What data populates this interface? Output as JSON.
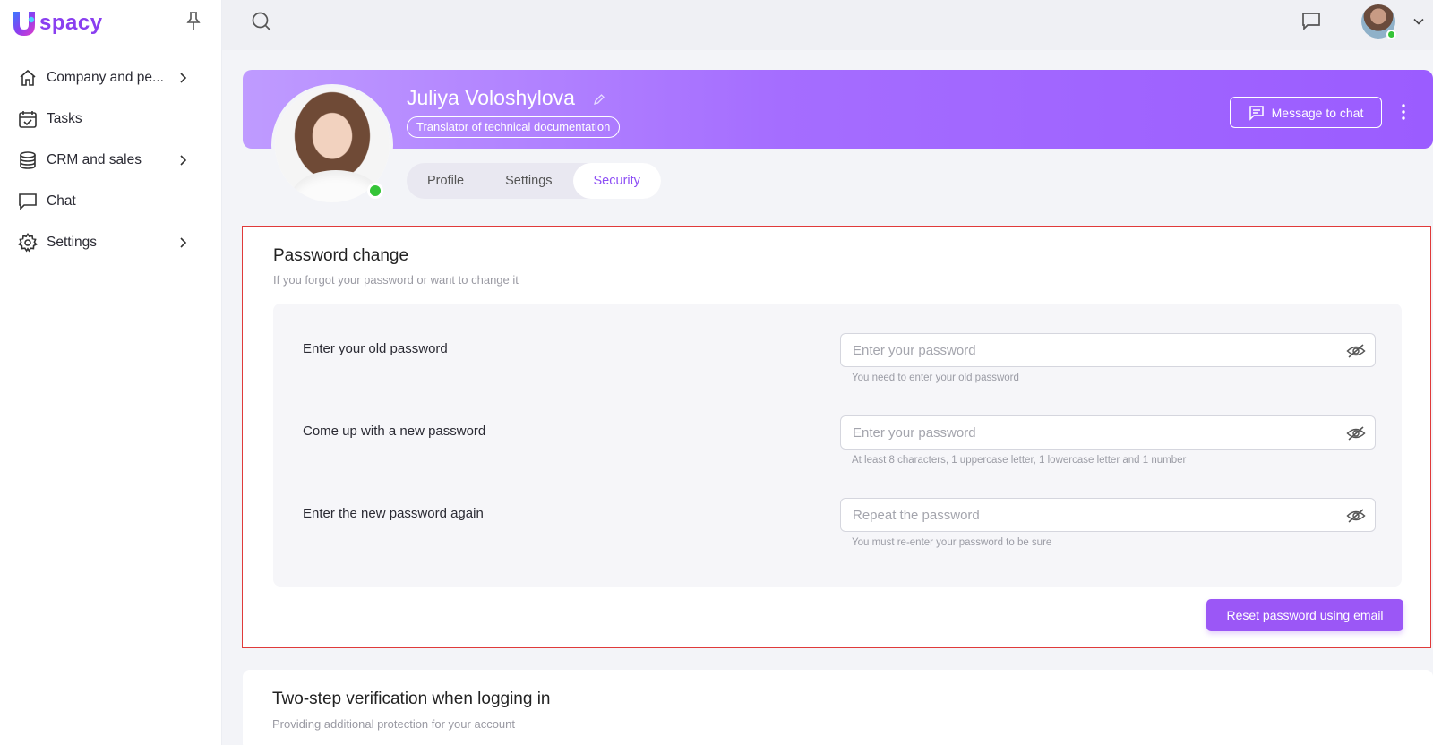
{
  "brand": {
    "name": "spacy",
    "accent": "#9b57f6"
  },
  "sidebar": {
    "items": [
      {
        "label": "Company and pe...",
        "icon": "home-icon",
        "has_children": true
      },
      {
        "label": "Tasks",
        "icon": "calendar-check-icon",
        "has_children": false
      },
      {
        "label": "CRM and sales",
        "icon": "database-icon",
        "has_children": true
      },
      {
        "label": "Chat",
        "icon": "chat-bubble-icon",
        "has_children": false
      },
      {
        "label": "Settings",
        "icon": "gear-icon",
        "has_children": true
      }
    ]
  },
  "profile": {
    "name": "Juliya Voloshylova",
    "role": "Translator of technical documentation",
    "message_button": "Message to chat",
    "status_color": "#35c437"
  },
  "tabs": [
    {
      "label": "Profile",
      "active": false
    },
    {
      "label": "Settings",
      "active": false
    },
    {
      "label": "Security",
      "active": true
    }
  ],
  "password_change": {
    "title": "Password change",
    "subtitle": "If you forgot your password or want to change it",
    "rows": [
      {
        "label": "Enter your old password",
        "placeholder": "Enter your password",
        "hint": "You need to enter your old password"
      },
      {
        "label": "Come up with a new password",
        "placeholder": "Enter your password",
        "hint": "At least 8 characters, 1 uppercase letter, 1 lowercase letter and 1 number"
      },
      {
        "label": "Enter the new password again",
        "placeholder": "Repeat the password",
        "hint": "You must re-enter your password to be sure"
      }
    ],
    "reset_button": "Reset password using email"
  },
  "two_step": {
    "title": "Two-step verification when logging in",
    "subtitle": "Providing additional protection for your account"
  }
}
